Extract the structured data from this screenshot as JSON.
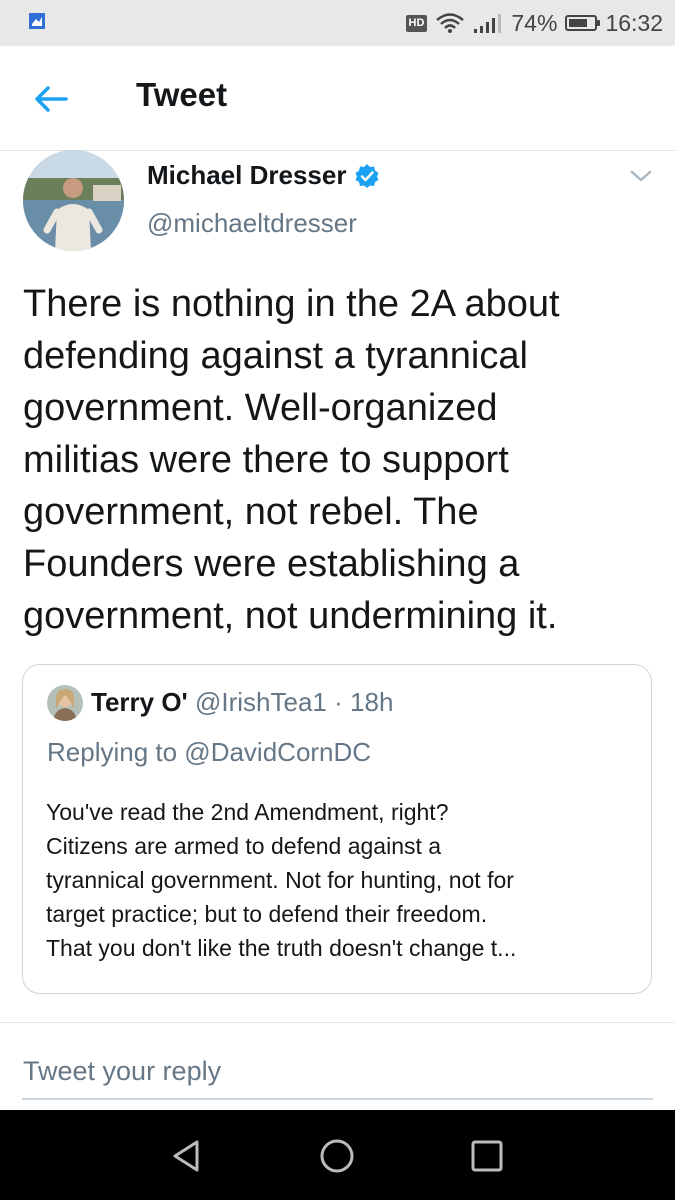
{
  "status_bar": {
    "network_badge": "HD",
    "battery_percent_label": "74%",
    "battery_level": 0.74,
    "time": "16:32",
    "icons": [
      "app-notification-icon",
      "wifi-icon",
      "signal-icon",
      "battery-icon"
    ]
  },
  "header": {
    "title": "Tweet",
    "back_icon": "arrow-left-icon"
  },
  "tweet": {
    "author_name": "Michael Dresser",
    "verified": true,
    "author_handle": "@michaeltdresser",
    "text": "There is nothing in the 2A about\ndefending against a tyrannical\ngovernment. Well-organized\nmilitias were there to support\ngovernment, not rebel. The\nFounders were establishing a\ngovernment, not undermining it.",
    "quoted": {
      "author_name": "Terry O'",
      "author_handle": "@IrishTea1",
      "separator": "·",
      "time": "18h",
      "replying_to": "Replying to @DavidCornDC",
      "text": "You've read the 2nd Amendment, right?\nCitizens are armed to defend against a\ntyrannical government. Not for hunting, not for\ntarget practice; but to defend their freedom.\nThat you don't like the truth doesn't change t..."
    }
  },
  "reply": {
    "placeholder": "Tweet your reply",
    "value": ""
  },
  "nav_bar": {
    "icons": [
      "nav-back-icon",
      "nav-home-icon",
      "nav-recents-icon"
    ]
  },
  "colors": {
    "accent": "#1da1f2",
    "text_primary": "#14171a",
    "text_secondary": "#657786",
    "border": "#ccd6dd",
    "status_bar_bg": "#e8e8e8",
    "nav_bar_bg": "#000000"
  }
}
